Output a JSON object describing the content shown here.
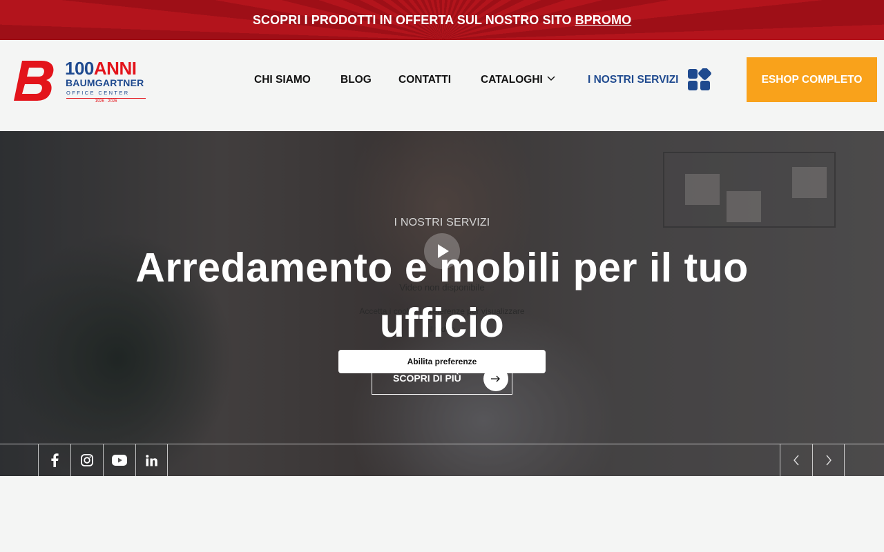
{
  "promo": {
    "text": "SCOPRI I PRODOTTI IN OFFERTA SUL NOSTRO SITO",
    "link": "BPROMO",
    "bg_color": "#b3141c"
  },
  "header": {
    "logo": {
      "anni_number": "100",
      "anni_word": "ANNI",
      "brand": "BAUMGARTNER",
      "subtitle": "OFFICE CENTER",
      "years": "1926 · 2026",
      "brand_red": "#e3141b",
      "brand_blue": "#1f4a8f"
    },
    "nav": {
      "chi_siamo": "CHI SIAMO",
      "blog": "BLOG",
      "contatti": "CONTATTI",
      "cataloghi": "CATALOGHI",
      "servizi": "I NOSTRI SERVIZI"
    },
    "eshop_label": "ESHOP COMPLETO",
    "eshop_color": "#f9a21b"
  },
  "hero": {
    "eyebrow": "I NOSTRI SERVIZI",
    "headline": "Arredamento e mobili per il tuo ufficio",
    "cta_label": "SCOPRI DI PIÙ",
    "video_unavailable": "Video non disponibile",
    "video_cookie_msg": "Accetta i cookie | Preferenze per visualizzare",
    "video_cookie_msg2": "il video",
    "enable_prefs_label": "Abilita preferenze"
  },
  "social": {
    "facebook": "facebook-icon",
    "instagram": "instagram-icon",
    "youtube": "youtube-icon",
    "linkedin": "linkedin-icon"
  }
}
